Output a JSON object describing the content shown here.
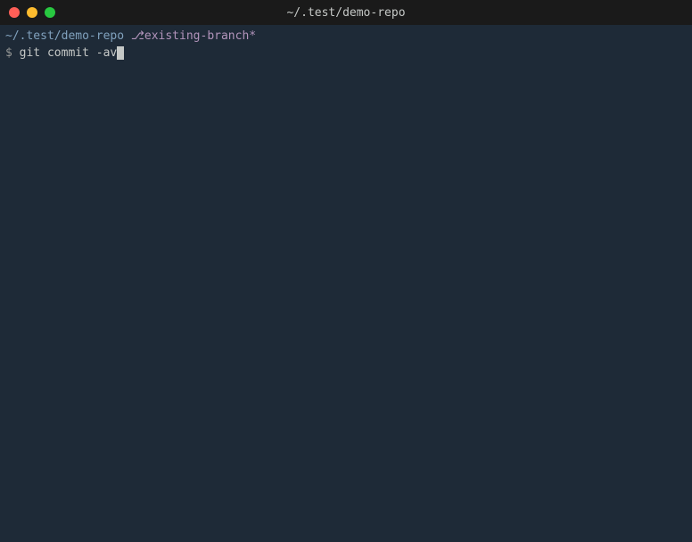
{
  "titlebar": {
    "title": "~/.test/demo-repo"
  },
  "prompt": {
    "cwd": "~/.test/demo-repo",
    "branch_prefix": "⎇",
    "branch": "existing-branch*",
    "symbol": "$",
    "command": "git commit -av"
  }
}
